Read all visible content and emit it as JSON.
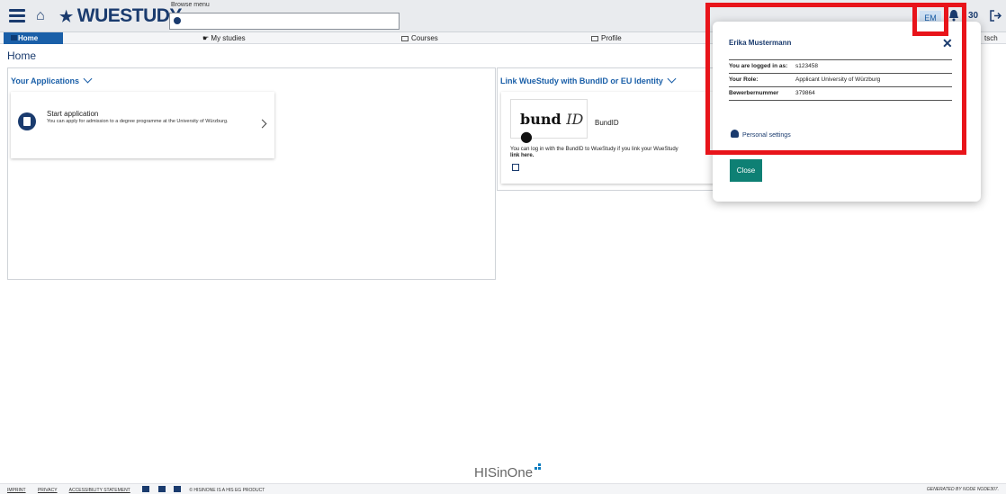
{
  "header": {
    "logo": "WUESTUDY",
    "browse_label": "Browse menu",
    "browse_placeholder": "",
    "user_initials": "EM",
    "notification_count": "30"
  },
  "nav": {
    "items": [
      {
        "label": "Home"
      },
      {
        "label": "My studies"
      },
      {
        "label": "Courses"
      },
      {
        "label": "Profile"
      },
      {
        "label": "tsch"
      }
    ]
  },
  "page": {
    "title": "Home"
  },
  "applications": {
    "title": "Your Applications",
    "card_title": "Start application",
    "card_desc": "You can apply for admission to a degree programme at the University of Würzburg."
  },
  "bundid": {
    "title": "Link WueStudy with BundID or EU Identity",
    "logo_text": "bund",
    "logo_id": "ID",
    "name": "BundID",
    "desc": "You can log in with the BundID to WueStudy if you link your WueStudy",
    "link_text": "link here."
  },
  "popup": {
    "user_name": "Erika Mustermann",
    "rows": [
      {
        "key": "You are logged in as:",
        "value": "s123458"
      },
      {
        "key": "Your Role:",
        "value": "Applicant University of Würzburg"
      },
      {
        "key": "Bewerbernummer",
        "value": "379864"
      }
    ],
    "settings_label": "Personal settings",
    "close_label": "Close"
  },
  "footer": {
    "brand": "HISinOne",
    "links": [
      "IMPRINT",
      "PRIVACY",
      "ACCESSIBILITY STATEMENT"
    ],
    "copyright": "© HISINONE IS A HIS EG PRODUCT",
    "generated": "GENERATED BY NODE NODE307."
  },
  "colors": {
    "brand_blue": "#1a3b6e",
    "active_nav": "#1a5fa8",
    "close_button": "#0e8074",
    "highlight": "#e8141a"
  }
}
